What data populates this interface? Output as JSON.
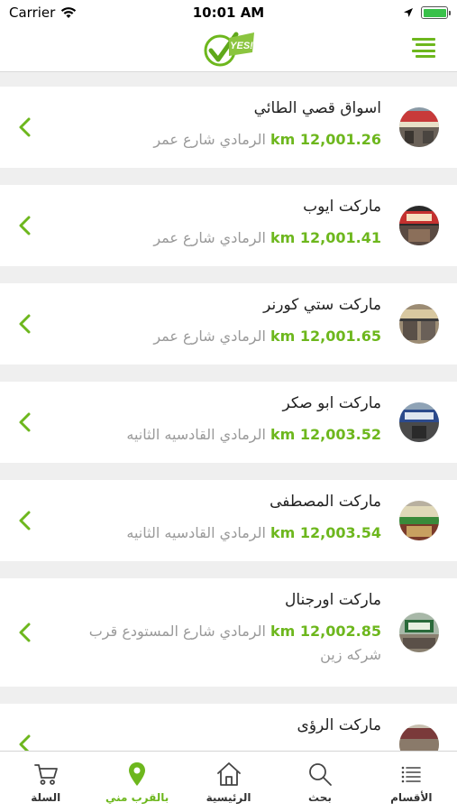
{
  "status_bar": {
    "carrier": "Carrier",
    "time": "10:01 AM"
  },
  "header": {
    "logo_text": "YES!"
  },
  "stores": [
    {
      "name": "اسواق قصي الطائي",
      "distance": "12,001.26 km",
      "address": "الرمادي شارع عمر"
    },
    {
      "name": "ماركت ايوب",
      "distance": "12,001.41 km",
      "address": "الرمادي شارع عمر"
    },
    {
      "name": "ماركت ستي كورنر",
      "distance": "12,001.65 km",
      "address": "الرمادي شارع عمر"
    },
    {
      "name": "ماركت ابو صكر",
      "distance": "12,003.52 km",
      "address": "الرمادي القادسيه الثانيه"
    },
    {
      "name": "ماركت المصطفى",
      "distance": "12,003.54 km",
      "address": "الرمادي القادسيه الثانيه"
    },
    {
      "name": "ماركت اورجنال",
      "distance": "12,002.85 km",
      "address": "الرمادي شارع المستودع قرب شركه زين"
    },
    {
      "name": "ماركت الرؤى",
      "distance": "",
      "address": ""
    }
  ],
  "tabs": [
    {
      "label": "السلة",
      "icon": "cart-icon"
    },
    {
      "label": "بالقرب مني",
      "icon": "location-pin-icon"
    },
    {
      "label": "الرئيسية",
      "icon": "home-icon"
    },
    {
      "label": "بحث",
      "icon": "search-icon"
    },
    {
      "label": "الأقسام",
      "icon": "categories-icon"
    }
  ],
  "colors": {
    "accent": "#6db71d",
    "text": "#222222",
    "muted": "#9a9a9a",
    "background": "#efefef"
  }
}
